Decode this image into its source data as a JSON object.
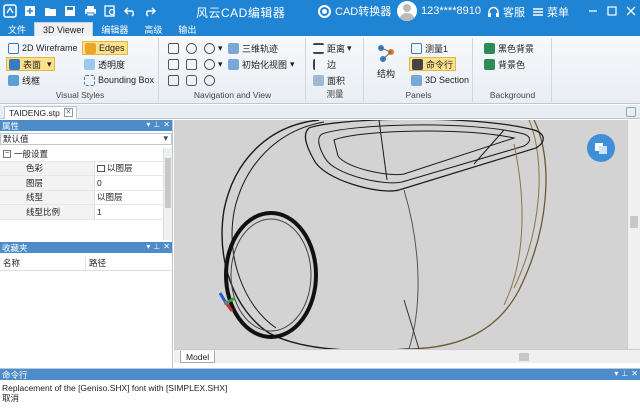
{
  "titlebar": {
    "title": "风云CAD编辑器",
    "converter": "CAD转换器",
    "user": "123****8910",
    "service": "客服",
    "menu": "菜单"
  },
  "tabs": [
    "文件",
    "3D Viewer",
    "编辑器",
    "高级",
    "输出"
  ],
  "ribbon": {
    "visual_styles": {
      "label": "Visual Styles",
      "wireframe": "2D Wireframe",
      "edges": "Edges",
      "surface": "表面",
      "transparency": "透明度",
      "lineframe": "线框",
      "bounding_box": "Bounding Box"
    },
    "navigation": {
      "label": "Navigation and View",
      "orbit": "三维轨迹",
      "init_view": "初始化视图"
    },
    "measure": {
      "label": "测量",
      "distance": "距离",
      "edge": "边",
      "area": "面积"
    },
    "panels": {
      "label": "Panels",
      "structure": "结构",
      "measure1": "测量1",
      "command_line": "命令行",
      "section": "3D Section"
    },
    "background": {
      "label": "Background",
      "black_bg": "黑色背景",
      "bg_color": "背景色"
    }
  },
  "document": {
    "tab": "TAIDENG.stp"
  },
  "properties": {
    "title": "属性",
    "combo": "默认值",
    "group": "一般设置",
    "rows": [
      {
        "key": "色彩",
        "value": "以图层"
      },
      {
        "key": "图层",
        "value": "0"
      },
      {
        "key": "线型",
        "value": "以图层"
      },
      {
        "key": "线型比例",
        "value": "1"
      }
    ]
  },
  "favorites": {
    "title": "收藏夹",
    "col_name": "名称",
    "col_path": "路径"
  },
  "viewport": {
    "model_tab": "Model"
  },
  "command": {
    "title": "命令行",
    "lines": [
      "Replacement of the [Geniso.SHX] font with [SIMPLEX.SHX]",
      "取消"
    ]
  },
  "colors": {
    "titlebar": "#1f84d3",
    "panel_header": "#4d8cc8",
    "viewport_bg": "#d3d3d3",
    "highlight": "#fde08a"
  }
}
